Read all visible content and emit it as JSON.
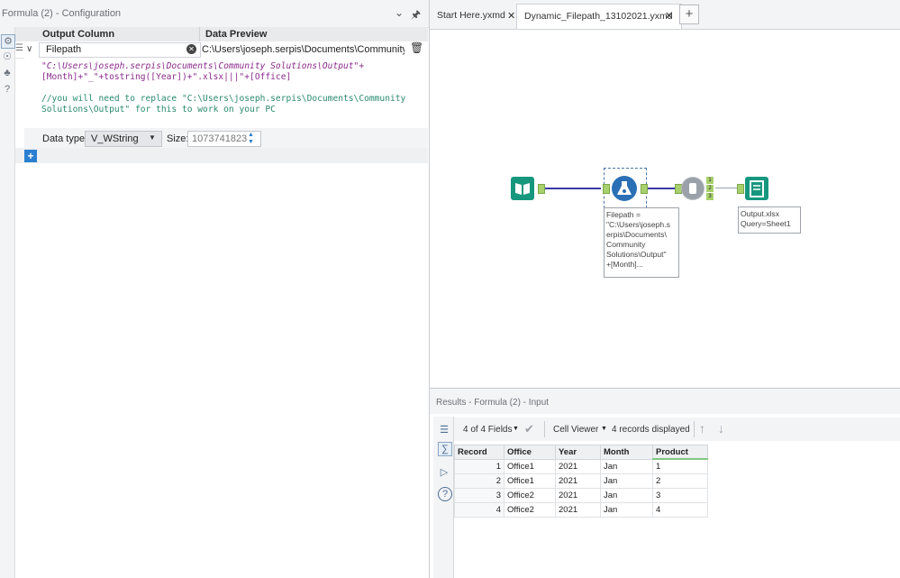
{
  "config": {
    "title": "Formula (2) - Configuration",
    "columns": {
      "output": "Output Column",
      "preview": "Data Preview"
    },
    "row": {
      "output_column": "Filepath",
      "preview": "C:\\Users\\joseph.serpis\\Documents\\Community Soluti..."
    },
    "expression_lines": [
      "\"C:\\Users\\joseph.serpis\\Documents\\Community Solutions\\Output\"+",
      "[Month]+\"_\"+tostring([Year])+\".xlsx|||\"+[Office]"
    ],
    "comment_lines": [
      "//you will need to replace \"C:\\Users\\joseph.serpis\\Documents\\Community",
      "Solutions\\Output\" for this to work on your PC"
    ],
    "datatype_label": "Data type:",
    "datatype_value": "V_WString",
    "size_label": "Size:",
    "size_value": "1073741823",
    "add_label": "+"
  },
  "tabs": [
    {
      "label": "Start Here.yxmd",
      "active": false
    },
    {
      "label": "Dynamic_Filepath_13102021.yxmd",
      "active": true
    }
  ],
  "new_tab_label": "+",
  "canvas": {
    "formula_annotation": [
      "Filepath =",
      "\"C:\\Users\\joseph.s",
      "erpis\\Documents\\",
      "Community",
      "Solutions\\Output\"",
      "+[Month]..."
    ],
    "output_annotation": [
      "Output.xlsx",
      "Query=Sheet1"
    ],
    "browse_anchors": [
      "1",
      "2",
      "3"
    ]
  },
  "results": {
    "title": "Results - Formula (2) - Input",
    "fields": "4 of 4 Fields",
    "viewer": "Cell Viewer",
    "records_displayed": "4 records displayed",
    "headers": [
      "Record",
      "Office",
      "Year",
      "Month",
      "Product"
    ],
    "rows": [
      [
        "1",
        "Office1",
        "2021",
        "Jan",
        "1"
      ],
      [
        "2",
        "Office1",
        "2021",
        "Jan",
        "2"
      ],
      [
        "3",
        "Office2",
        "2021",
        "Jan",
        "3"
      ],
      [
        "4",
        "Office2",
        "2021",
        "Jan",
        "4"
      ]
    ]
  },
  "colors": {
    "tool_teal": "#16977e",
    "tool_blue": "#2a6fb5",
    "connector": "#3a3aa6",
    "anchor": "#a8d06c",
    "accent": "#2a7fd0"
  }
}
